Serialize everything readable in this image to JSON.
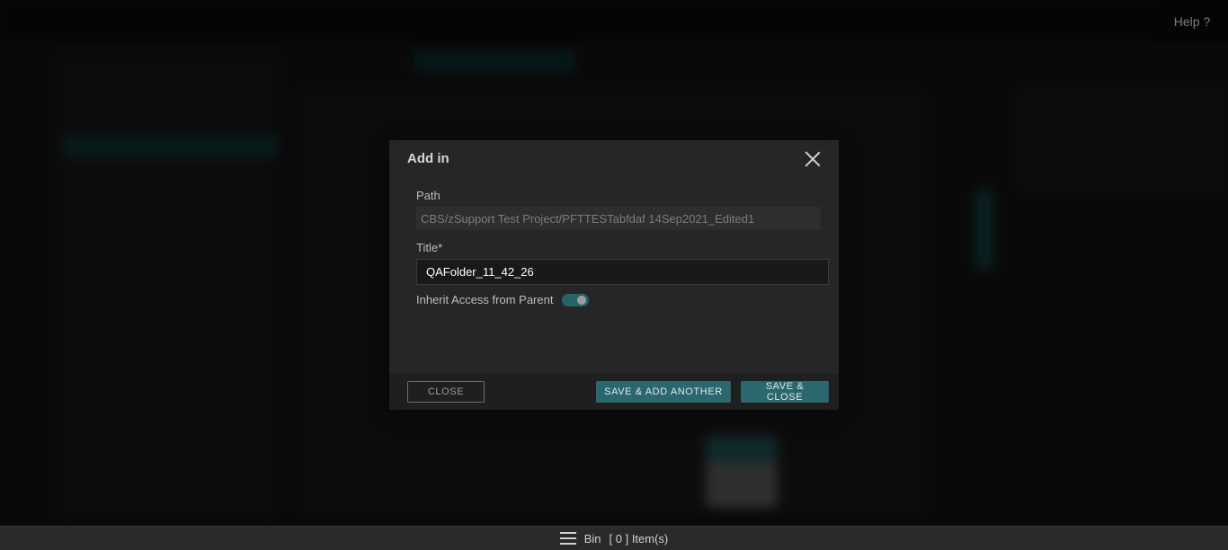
{
  "header": {
    "help_label": "Help ?"
  },
  "dialog": {
    "title": "Add in",
    "path_label": "Path",
    "path_value": "CBS/zSupport Test Project/PFTTESTabfdaf 14Sep2021_Edited1",
    "title_label": "Title*",
    "title_value": "QAFolder_11_42_26",
    "inherit_label": "Inherit Access from Parent",
    "inherit_enabled": true,
    "close_label": "CLOSE",
    "save_add_label": "SAVE & ADD ANOTHER",
    "save_close_label": "SAVE & CLOSE"
  },
  "bin": {
    "label": "Bin",
    "count_text": "[ 0 ] Item(s)"
  },
  "colors": {
    "accent": "#2a6870",
    "toggle_on": "#24656b",
    "modal_bg": "#262626"
  }
}
